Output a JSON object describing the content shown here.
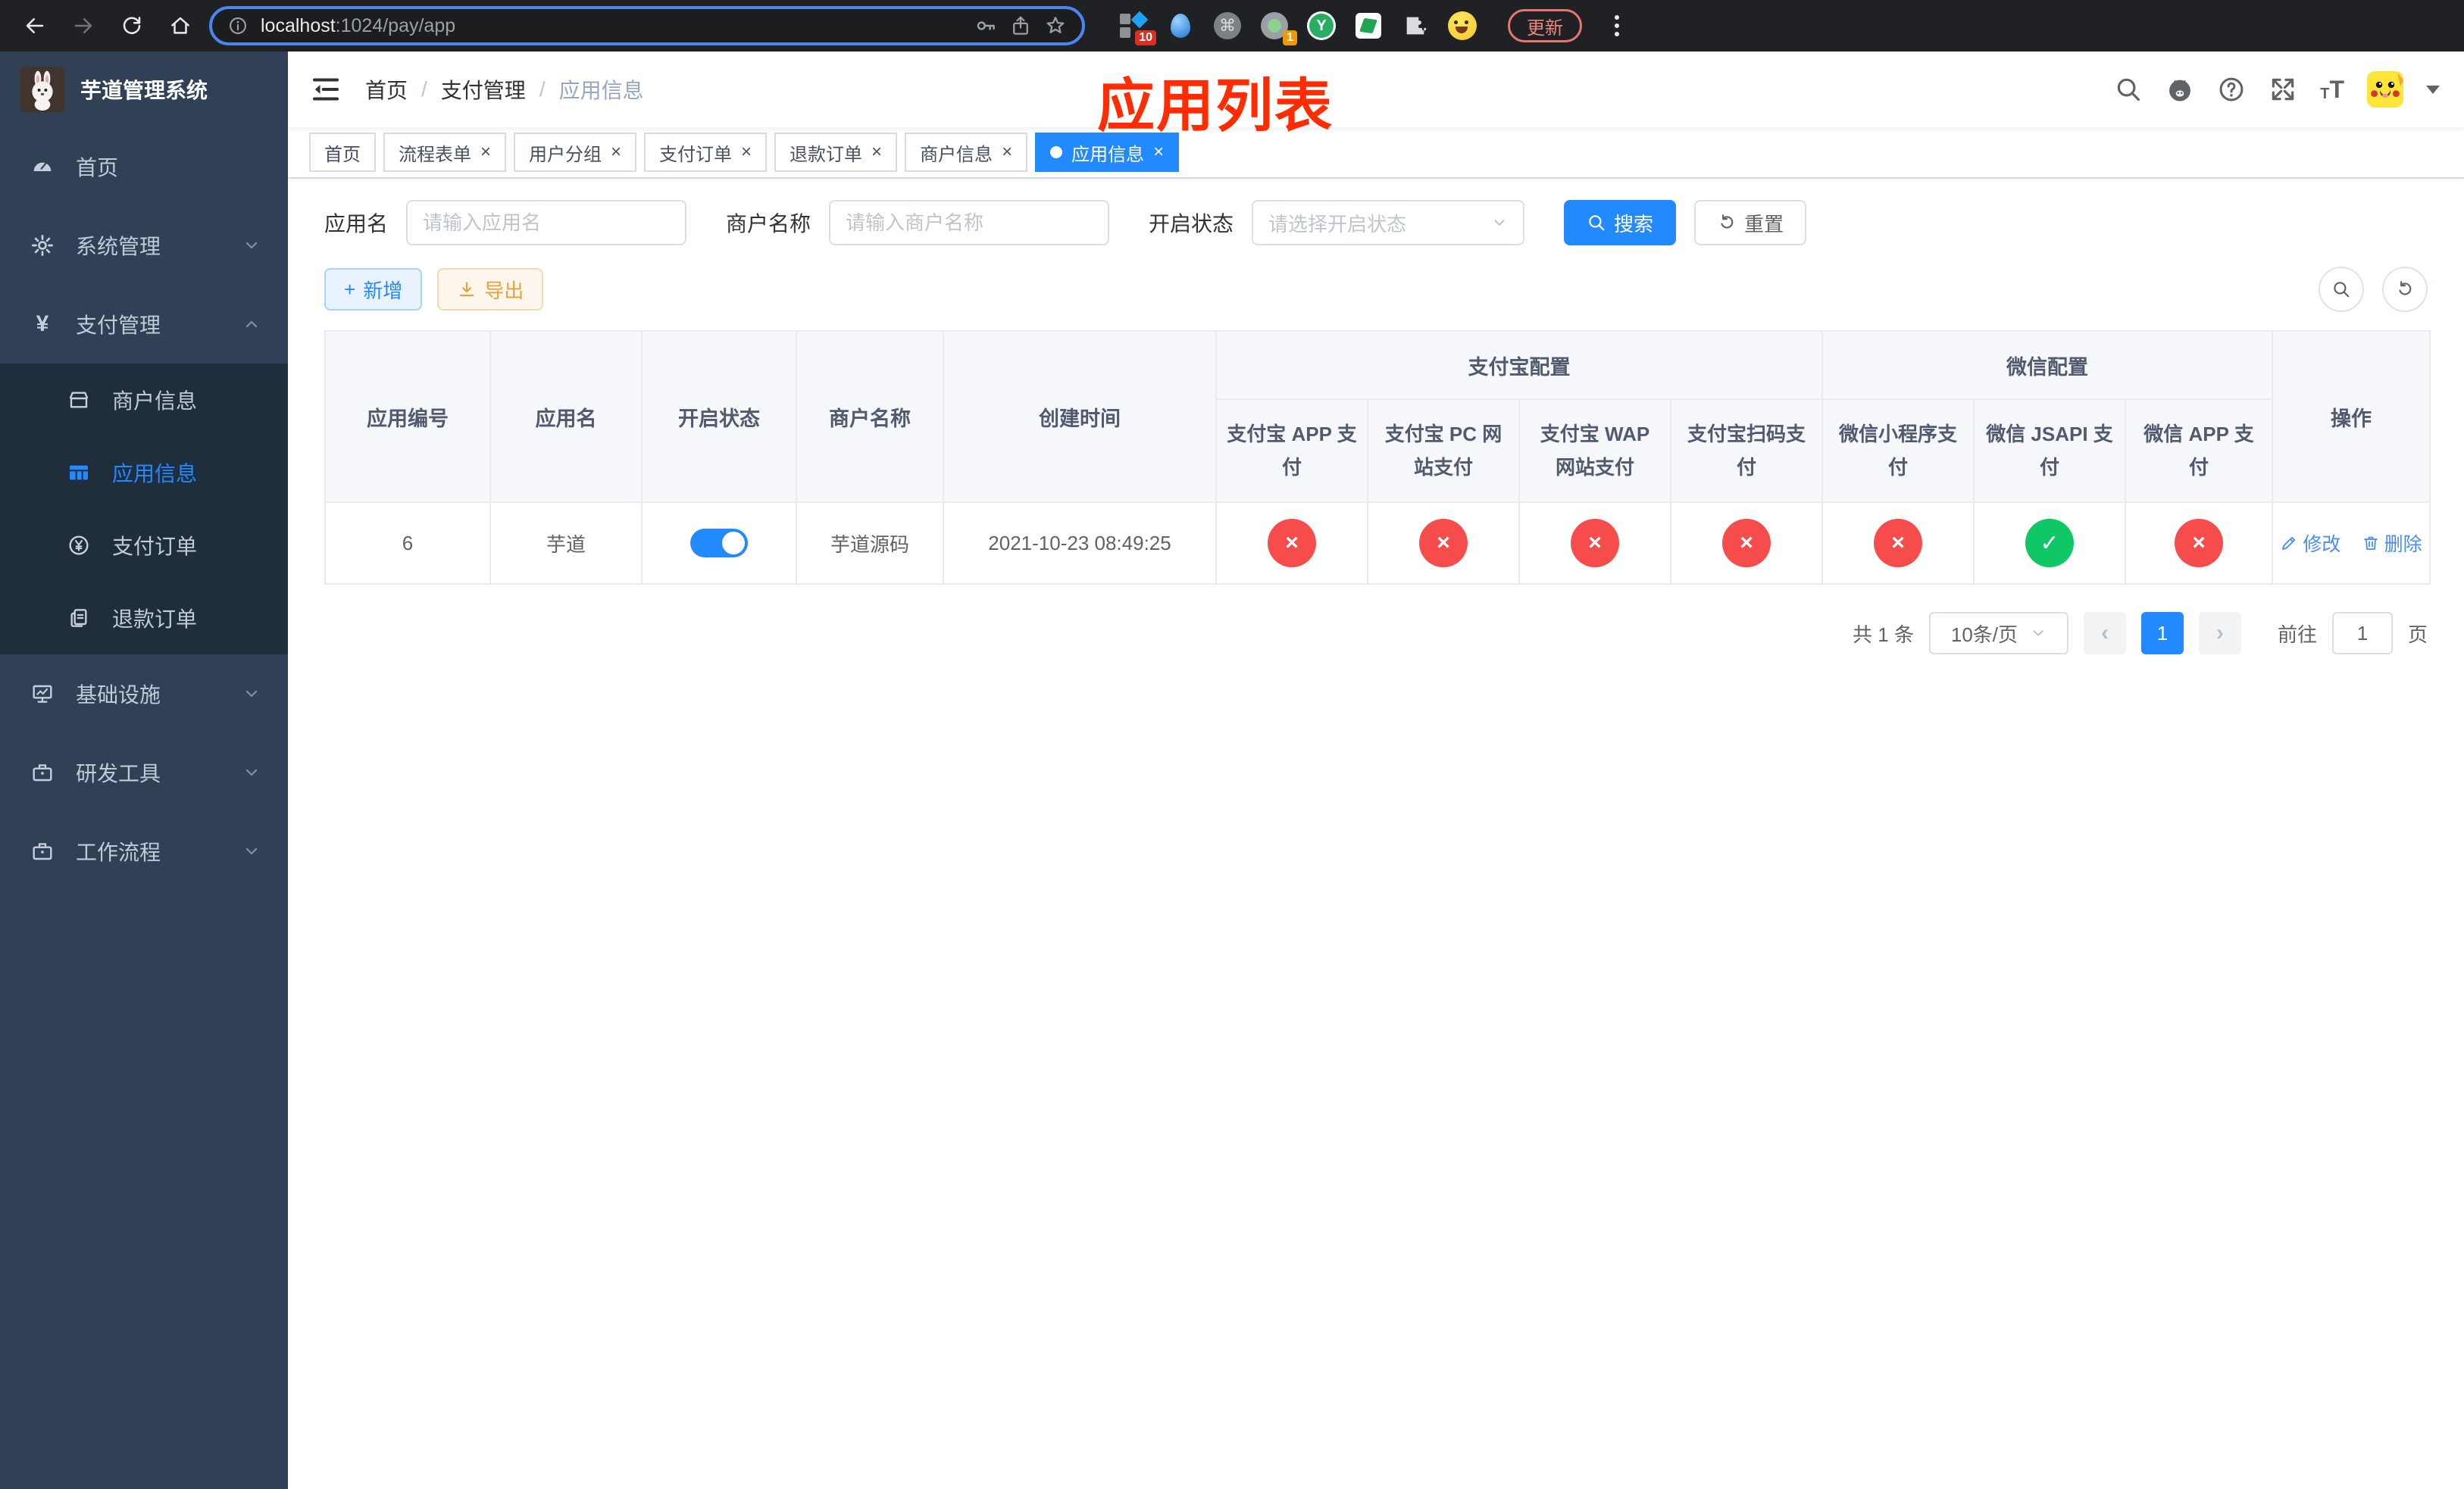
{
  "colors": {
    "primary": "#2389ff",
    "danger": "#f74c4c",
    "success": "#0fc764",
    "warning": "#e6a23c",
    "annotation_red": "#fe2c00",
    "sidebar_bg": "#304156",
    "submenu_bg": "#1f2d3d"
  },
  "glyphs": {
    "check": "✓",
    "cross": "×",
    "tab_close": "×",
    "prev": "‹",
    "next": "›",
    "sep": "/",
    "plus": "+",
    "command": "⌘",
    "yen": "¥",
    "y_letter": "Y",
    "t_small": "T",
    "t_big": "T",
    "question": "?"
  },
  "browser": {
    "url_host": "localhost",
    "url_rest": ":1024/pay/app",
    "ext_badge_grid": "10",
    "ext_badge_lens": "1",
    "update_label": "更新"
  },
  "sidebar": {
    "logo_title": "芋道管理系统",
    "items": [
      {
        "label": "首页"
      },
      {
        "label": "系统管理"
      },
      {
        "label": "支付管理"
      },
      {
        "label": "商户信息"
      },
      {
        "label": "应用信息"
      },
      {
        "label": "支付订单"
      },
      {
        "label": "退款订单"
      },
      {
        "label": "基础设施"
      },
      {
        "label": "研发工具"
      },
      {
        "label": "工作流程"
      }
    ]
  },
  "navbar": {
    "breadcrumb": [
      "首页",
      "支付管理",
      "应用信息"
    ],
    "annotation": "应用列表"
  },
  "tabs": {
    "items": [
      {
        "label": "首页"
      },
      {
        "label": "流程表单"
      },
      {
        "label": "用户分组"
      },
      {
        "label": "支付订单"
      },
      {
        "label": "退款订单"
      },
      {
        "label": "商户信息"
      },
      {
        "label": "应用信息"
      }
    ]
  },
  "filters": {
    "app_name": {
      "label": "应用名",
      "placeholder": "请输入应用名"
    },
    "merchant_name": {
      "label": "商户名称",
      "placeholder": "请输入商户名称"
    },
    "status": {
      "label": "开启状态",
      "placeholder": "请选择开启状态"
    },
    "search_label": "搜索",
    "reset_label": "重置"
  },
  "toolbar": {
    "add_label": "新增",
    "export_label": "导出"
  },
  "table": {
    "group_alipay": "支付宝配置",
    "group_wechat": "微信配置",
    "columns_fixed": [
      "应用编号",
      "应用名",
      "开启状态",
      "商户名称",
      "创建时间"
    ],
    "columns_alipay": [
      "支付宝 APP 支付",
      "支付宝 PC 网站支付",
      "支付宝 WAP 网站支付",
      "支付宝扫码支付"
    ],
    "columns_wechat": [
      "微信小程序支付",
      "微信 JSAPI 支付",
      "微信 APP 支付"
    ],
    "actions_label": "操作",
    "edit_label": "修改",
    "delete_label": "删除",
    "rows": [
      {
        "app_id": "6",
        "app_name": "芋道",
        "enabled": true,
        "merchant_name": "芋道源码",
        "create_time": "2021-10-23 08:49:25",
        "channels": [
          false,
          false,
          false,
          false,
          false,
          true,
          false
        ]
      }
    ]
  },
  "pagination": {
    "total_text": "共 1 条",
    "page_size_text": "10条/页",
    "current_page": "1",
    "goto_label": "前往",
    "goto_value": "1",
    "page_unit": "页"
  }
}
